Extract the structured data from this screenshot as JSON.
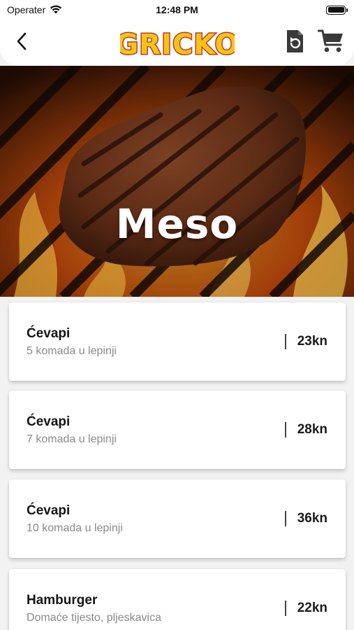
{
  "status_bar": {
    "carrier": "Operater",
    "time": "12:48 PM"
  },
  "header": {
    "logo_text": "GRICKO",
    "back_icon": "chevron-left-icon",
    "refresh_icon": "refresh-icon",
    "cart_icon": "cart-icon"
  },
  "hero": {
    "title": "Meso"
  },
  "items": [
    {
      "name": "Ćevapi",
      "description": "5 komada u lepinji",
      "price": "23kn"
    },
    {
      "name": "Ćevapi",
      "description": "7 komada u lepinji",
      "price": "28kn"
    },
    {
      "name": "Ćevapi",
      "description": "10 komada u lepinji",
      "price": "36kn"
    },
    {
      "name": "Hamburger",
      "description": "Domaće tijesto, pljeskavica",
      "price": "22kn"
    }
  ],
  "colors": {
    "logo_fill": "#f7c416",
    "logo_outline": "#c0392b",
    "icon_color": "#3a3a3a"
  }
}
